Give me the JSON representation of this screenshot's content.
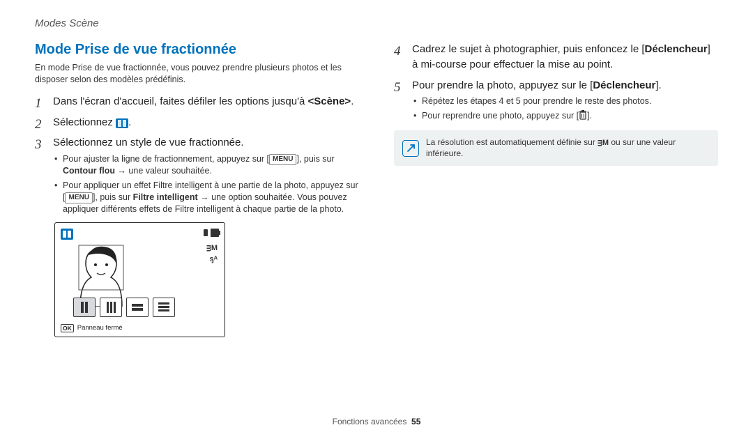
{
  "header": {
    "breadcrumb": "Modes Scène"
  },
  "section": {
    "title": "Mode Prise de vue fractionnée",
    "intro": "En mode Prise de vue fractionnée, vous pouvez prendre plusieurs photos et les disposer selon des modèles prédéfinis."
  },
  "steps_left": {
    "s1_pre": "Dans l'écran d'accueil, faites défiler les options jusqu'à ",
    "s1_bold": "<Scène>",
    "s1_post": ".",
    "s2_pre": "Sélectionnez ",
    "s2_post": ".",
    "s3": "Sélectionnez un style de vue fractionnée.",
    "s3_b1_pre": "Pour ajuster la ligne de fractionnement, appuyez sur [",
    "s3_b1_menu": "MENU",
    "s3_b1_mid": "], puis sur ",
    "s3_b1_bold": "Contour flou",
    "s3_b1_post": " → une valeur souhaitée.",
    "s3_b2_pre": "Pour appliquer un effet Filtre intelligent à une partie de la photo, appuyez sur [",
    "s3_b2_menu": "MENU",
    "s3_b2_mid": "], puis sur ",
    "s3_b2_bold": "Filtre intelligent",
    "s3_b2_post": " → une option souhaitée. Vous pouvez appliquer différents effets de Filtre intelligent à chaque partie de la photo."
  },
  "steps_right": {
    "s4_pre": "Cadrez le sujet à photographier, puis enfoncez le [",
    "s4_bold": "Déclencheur",
    "s4_post": "] à mi-course pour effectuer la mise au point.",
    "s5_pre": "Pour prendre la photo, appuyez sur le [",
    "s5_bold": "Déclencheur",
    "s5_post": "].",
    "s5_b1": "Répétez les étapes 4 et 5 pour prendre le reste des photos.",
    "s5_b2_pre": "Pour reprendre une photo, appuyez sur [",
    "s5_b2_post": "]."
  },
  "note": {
    "text_pre": "La résolution est automatiquement définie sur ",
    "res_label": "ᴟM",
    "text_post": " ou sur une valeur inférieure."
  },
  "cam": {
    "res": "ᴟM",
    "flash": "ᶊᴬ",
    "footer_ok": "OK",
    "footer_label": "Panneau fermé"
  },
  "footer": {
    "section": "Fonctions avancées",
    "page": "55"
  }
}
